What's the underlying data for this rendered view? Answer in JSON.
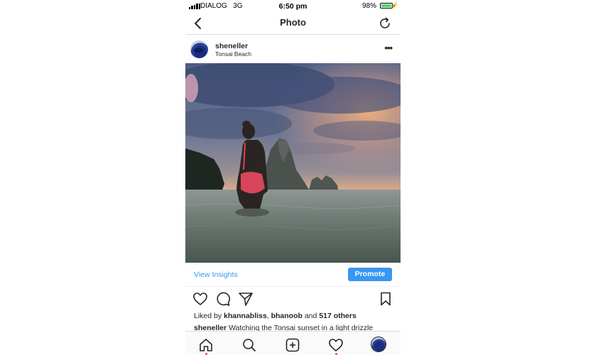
{
  "status_bar": {
    "carrier": "DIALOG",
    "network": "3G",
    "time": "6:50 pm",
    "battery_percent": "98%",
    "battery_level": 0.98,
    "battery_color": "#4cd964"
  },
  "nav": {
    "title": "Photo",
    "back_icon": "chevron-left-icon",
    "refresh_icon": "refresh-icon"
  },
  "post": {
    "username": "sheneller",
    "location": "Tonsai Beach",
    "more_icon": "more-horizontal-icon",
    "photo_subject": "silhouette-in-sea-at-sunset"
  },
  "insights": {
    "view_label": "View Insights",
    "promote_label": "Promote",
    "accent": "#3897f0"
  },
  "likes": {
    "prefix": "Liked by",
    "user1": "khannabliss",
    "sep": ",",
    "user2": "bhanoob",
    "and": "and",
    "others": "517 others"
  },
  "caption": {
    "user": "sheneller",
    "text": "Watching the Tonsai sunset in a light drizzle"
  },
  "tabbar": {
    "items": [
      "home-icon",
      "search-icon",
      "add-post-icon",
      "activity-heart-icon",
      "profile-avatar"
    ],
    "notification_color": "#ed4956"
  }
}
